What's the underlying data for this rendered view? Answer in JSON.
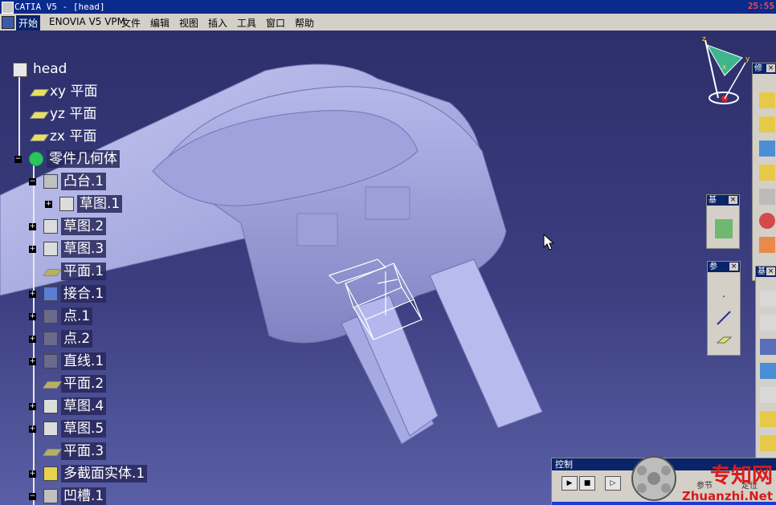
{
  "window": {
    "title": "CATIA V5 - [head]",
    "clock": "25:55"
  },
  "menu": {
    "items": [
      "开始",
      "ENOVIA V5 VPM",
      "文件",
      "编辑",
      "视图",
      "插入",
      "工具",
      "窗口",
      "帮助"
    ],
    "active_index": 0
  },
  "tree": {
    "root": "head",
    "nodes": [
      {
        "label": "xy 平面",
        "icon": "plane-icon"
      },
      {
        "label": "yz 平面",
        "icon": "plane-icon"
      },
      {
        "label": "zx 平面",
        "icon": "plane-icon"
      },
      {
        "label": "零件几何体",
        "icon": "part-body-gear-icon"
      },
      {
        "label": "凸台.1",
        "icon": "pad-icon"
      },
      {
        "label": "草图.1",
        "icon": "sketch-icon"
      },
      {
        "label": "草图.2",
        "icon": "sketch-icon"
      },
      {
        "label": "草图.3",
        "icon": "sketch-icon"
      },
      {
        "label": "平面.1",
        "icon": "plane-feature-icon"
      },
      {
        "label": "接合.1",
        "icon": "join-icon"
      },
      {
        "label": "点.1",
        "icon": "point-icon"
      },
      {
        "label": "点.2",
        "icon": "point-icon"
      },
      {
        "label": "直线.1",
        "icon": "line-icon"
      },
      {
        "label": "平面.2",
        "icon": "plane-feature-icon"
      },
      {
        "label": "草图.4",
        "icon": "sketch-icon"
      },
      {
        "label": "草图.5",
        "icon": "sketch-icon"
      },
      {
        "label": "平面.3",
        "icon": "plane-feature-icon"
      },
      {
        "label": "多截面实体.1",
        "icon": "multi-section-solid-icon"
      },
      {
        "label": "凹槽.1",
        "icon": "pocket-icon"
      }
    ]
  },
  "compass": {
    "axis_x": "x",
    "axis_y": "y",
    "axis_z": "z"
  },
  "toolbars": {
    "dress_up": {
      "title": "修"
    },
    "base_small": {
      "title": "基"
    },
    "reference": {
      "title": "参"
    },
    "base_large": {
      "title": "基"
    }
  },
  "control_panel": {
    "title": "控制",
    "labels": [
      "参节",
      "定位"
    ]
  },
  "watermark": {
    "cn": "专知网",
    "url": "Zhuanzhi.Net"
  },
  "colors": {
    "title_bar": "#0a2a8c",
    "menu_bg": "#d4d0c8",
    "model": "#a9aee6",
    "clock": "#ff4444"
  }
}
